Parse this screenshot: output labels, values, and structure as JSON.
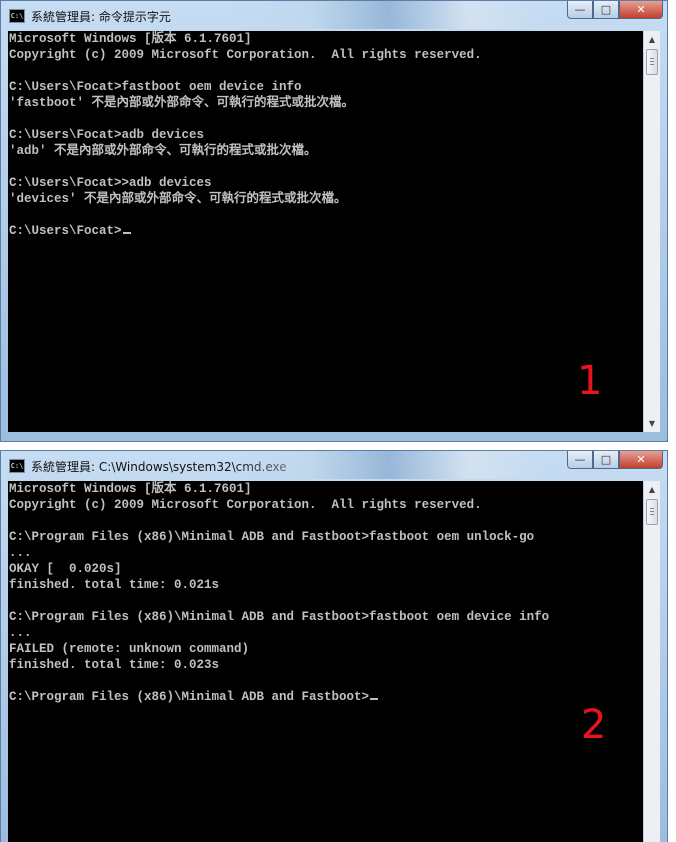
{
  "window1": {
    "title": "系統管理員: 命令提示字元",
    "marker": "1",
    "lines": [
      "Microsoft Windows [版本 6.1.7601]",
      "Copyright (c) 2009 Microsoft Corporation.  All rights reserved.",
      "",
      "C:\\Users\\Focat>fastboot oem device info",
      "'fastboot' 不是內部或外部命令、可執行的程式或批次檔。",
      "",
      "C:\\Users\\Focat>adb devices",
      "'adb' 不是內部或外部命令、可執行的程式或批次檔。",
      "",
      "C:\\Users\\Focat>>adb devices",
      "'devices' 不是內部或外部命令、可執行的程式或批次檔。",
      "",
      "C:\\Users\\Focat>"
    ]
  },
  "window2": {
    "title": "系統管理員: C:\\Windows\\system32\\cmd.exe",
    "marker": "2",
    "lines": [
      "Microsoft Windows [版本 6.1.7601]",
      "Copyright (c) 2009 Microsoft Corporation.  All rights reserved.",
      "",
      "C:\\Program Files (x86)\\Minimal ADB and Fastboot>fastboot oem unlock-go",
      "...",
      "OKAY [  0.020s]",
      "finished. total time: 0.021s",
      "",
      "C:\\Program Files (x86)\\Minimal ADB and Fastboot>fastboot oem device info",
      "...",
      "FAILED (remote: unknown command)",
      "finished. total time: 0.023s",
      "",
      "C:\\Program Files (x86)\\Minimal ADB and Fastboot>"
    ]
  },
  "controls": {
    "minimize": "—",
    "maximize": "□",
    "close": "✕"
  },
  "icons": {
    "console": "console-icon",
    "scroll_up": "▲",
    "scroll_down": "▼"
  },
  "colors": {
    "console_bg": "#000000",
    "console_text": "#c0c0c0",
    "marker": "#e8131d"
  }
}
